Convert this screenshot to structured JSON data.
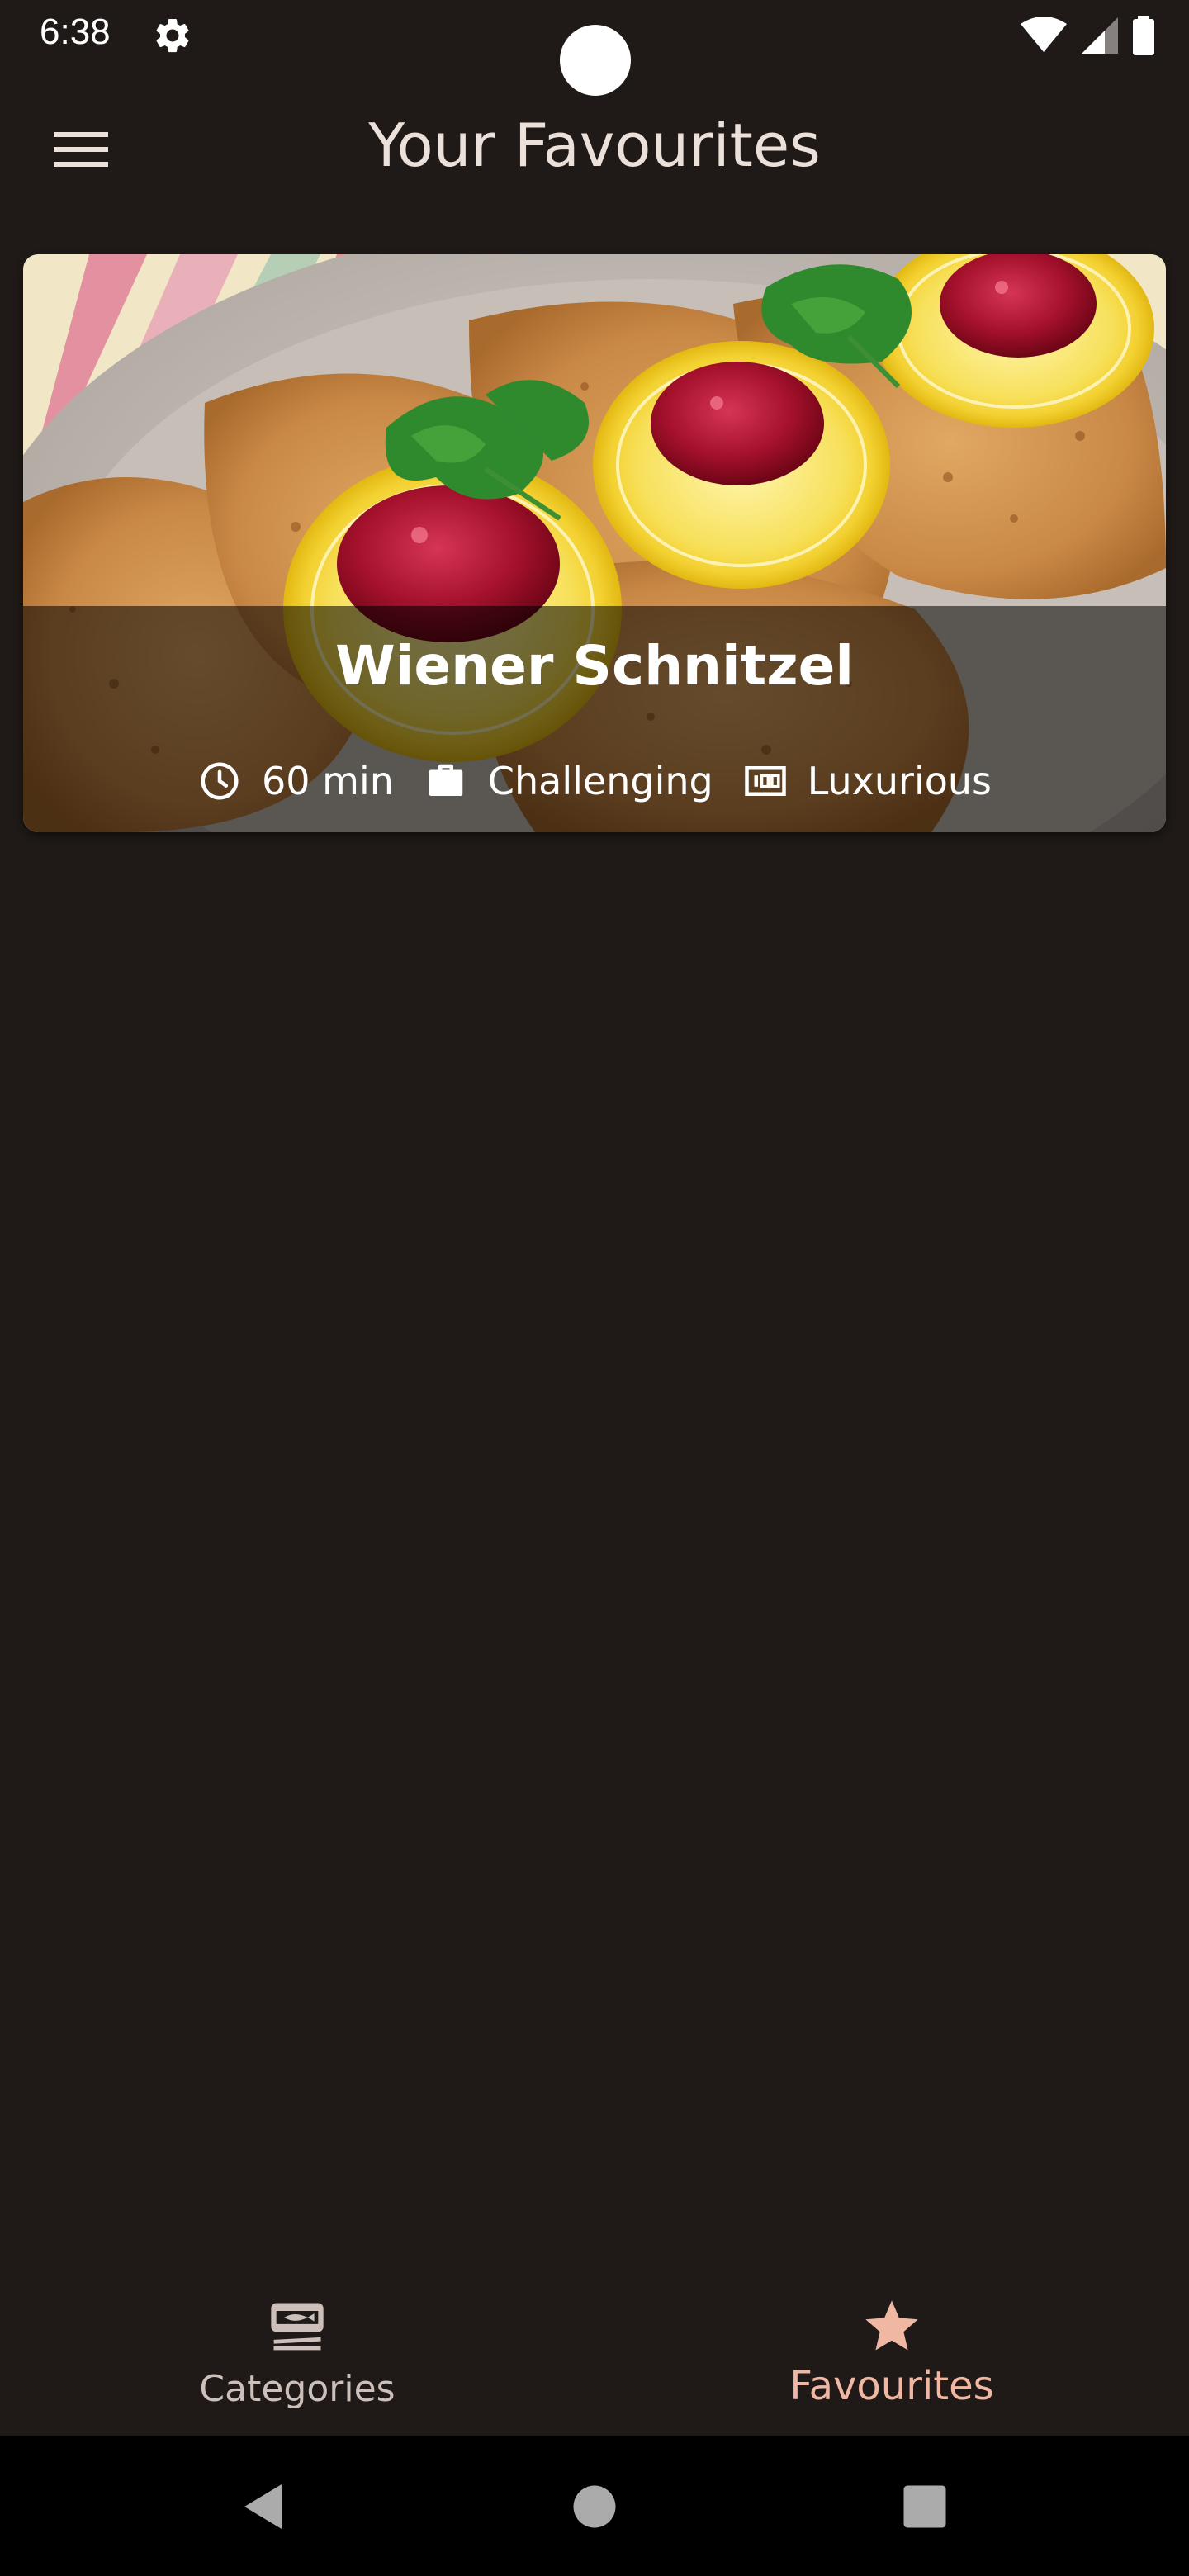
{
  "status_bar": {
    "time": "6:38"
  },
  "app_bar": {
    "title": "Your Favourites"
  },
  "meals": [
    {
      "title": "Wiener Schnitzel",
      "duration": "60 min",
      "complexity": "Challenging",
      "affordability": "Luxurious"
    }
  ],
  "bottom_nav": {
    "items": [
      {
        "label": "Categories",
        "icon": "set-meal-icon",
        "selected": false
      },
      {
        "label": "Favourites",
        "icon": "star-icon",
        "selected": true
      }
    ]
  },
  "colors": {
    "background": "#1f1a17",
    "on_surface": "#ece0da",
    "selected_accent": "#f0b8a3",
    "unselected": "#cdbfba",
    "system_nav": "#000000"
  }
}
